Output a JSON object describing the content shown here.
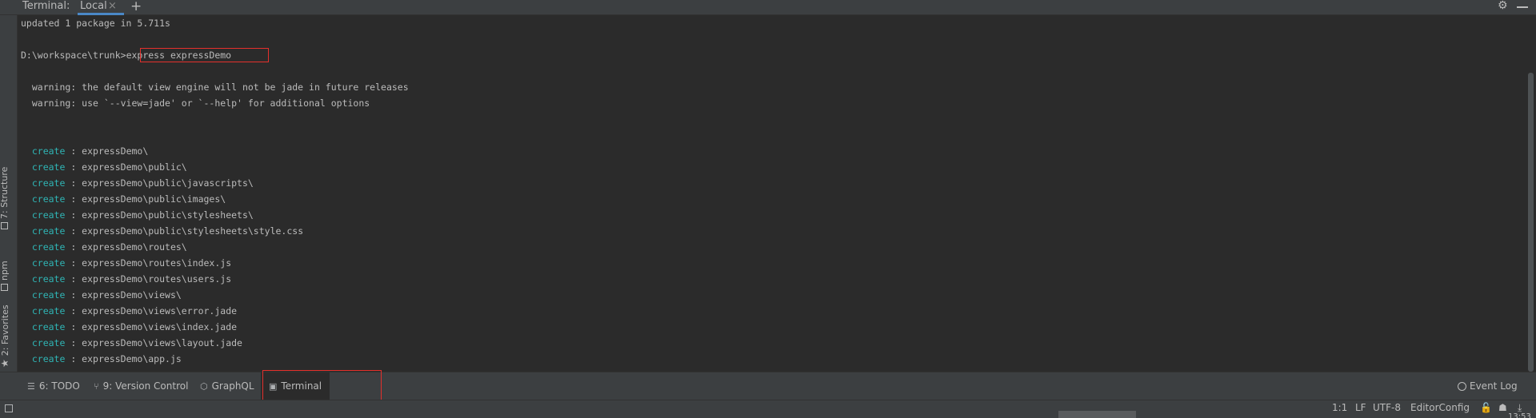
{
  "tool_window": {
    "title": "Terminal:",
    "tab_label": "Local",
    "tab_close": "×",
    "add_label": "+",
    "gear": "⚙"
  },
  "left_tabs": [
    {
      "label": "7: Structure"
    },
    {
      "label": "npm"
    },
    {
      "label": "2: Favorites"
    }
  ],
  "terminal": {
    "lines": [
      {
        "text": "updated 1 package in 5.711s"
      },
      {
        "text": ""
      },
      {
        "prompt": "D:\\workspace\\trunk>",
        "command": "express expressDemo"
      },
      {
        "text": ""
      },
      {
        "text": "  warning: the default view engine will not be jade in future releases"
      },
      {
        "text": "  warning: use `--view=jade' or `--help' for additional options"
      },
      {
        "text": ""
      },
      {
        "text": ""
      },
      {
        "keyword": "create",
        "text": " : expressDemo\\"
      },
      {
        "keyword": "create",
        "text": " : expressDemo\\public\\"
      },
      {
        "keyword": "create",
        "text": " : expressDemo\\public\\javascripts\\"
      },
      {
        "keyword": "create",
        "text": " : expressDemo\\public\\images\\"
      },
      {
        "keyword": "create",
        "text": " : expressDemo\\public\\stylesheets\\"
      },
      {
        "keyword": "create",
        "text": " : expressDemo\\public\\stylesheets\\style.css"
      },
      {
        "keyword": "create",
        "text": " : expressDemo\\routes\\"
      },
      {
        "keyword": "create",
        "text": " : expressDemo\\routes\\index.js"
      },
      {
        "keyword": "create",
        "text": " : expressDemo\\routes\\users.js"
      },
      {
        "keyword": "create",
        "text": " : expressDemo\\views\\"
      },
      {
        "keyword": "create",
        "text": " : expressDemo\\views\\error.jade"
      },
      {
        "keyword": "create",
        "text": " : expressDemo\\views\\index.jade"
      },
      {
        "keyword": "create",
        "text": " : expressDemo\\views\\layout.jade"
      },
      {
        "keyword": "create",
        "text": " : expressDemo\\app.js"
      }
    ]
  },
  "bottom_tabs": {
    "todo": "6: TODO",
    "version_control": "9: Version Control",
    "graphql": "GraphQL",
    "terminal": "Terminal",
    "event_log": "Event Log"
  },
  "status_bar": {
    "position": "1:1",
    "line_separator": "LF",
    "encoding": "UTF-8",
    "editor_config": "EditorConfig",
    "time": "13:53"
  },
  "colors": {
    "background": "#2b2b2b",
    "panel": "#3c3f41",
    "keyword": "#2fb5b5",
    "highlight_box": "#e5302c",
    "tab_underline": "#4a88c7"
  }
}
